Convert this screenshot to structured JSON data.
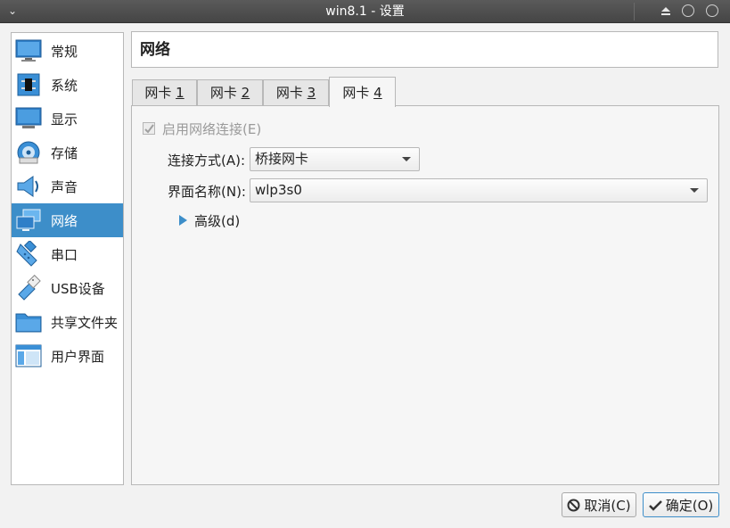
{
  "window": {
    "title": "win8.1 - 设置",
    "menu_glyph": "⌄"
  },
  "sidebar": {
    "items": [
      {
        "label": "常规",
        "icon": "general-icon"
      },
      {
        "label": "系统",
        "icon": "system-icon"
      },
      {
        "label": "显示",
        "icon": "display-icon"
      },
      {
        "label": "存储",
        "icon": "storage-icon"
      },
      {
        "label": "声音",
        "icon": "audio-icon"
      },
      {
        "label": "网络",
        "icon": "network-icon",
        "selected": true
      },
      {
        "label": "串口",
        "icon": "serial-port-icon"
      },
      {
        "label": "USB设备",
        "icon": "usb-icon"
      },
      {
        "label": "共享文件夹",
        "icon": "shared-folder-icon"
      },
      {
        "label": "用户界面",
        "icon": "user-interface-icon"
      }
    ]
  },
  "main": {
    "page_title": "网络",
    "tabs": [
      {
        "prefix": "网卡 ",
        "mnemonic": "1"
      },
      {
        "prefix": "网卡 ",
        "mnemonic": "2"
      },
      {
        "prefix": "网卡 ",
        "mnemonic": "3"
      },
      {
        "prefix": "网卡 ",
        "mnemonic": "4",
        "active": true
      }
    ],
    "enable_checkbox": {
      "label": "启用网络连接(E)",
      "checked": true,
      "disabled": true
    },
    "attached_to": {
      "label": "连接方式(A):",
      "value": "桥接网卡"
    },
    "interface_name": {
      "label": "界面名称(N):",
      "value": "wlp3s0"
    },
    "advanced": {
      "label": "高级(d)"
    }
  },
  "buttons": {
    "cancel": "取消(C)",
    "ok": "确定(O)"
  },
  "colors": {
    "accent": "#3d8ec9",
    "titlebar": "#4f4f4f",
    "background": "#f2f2f2"
  }
}
